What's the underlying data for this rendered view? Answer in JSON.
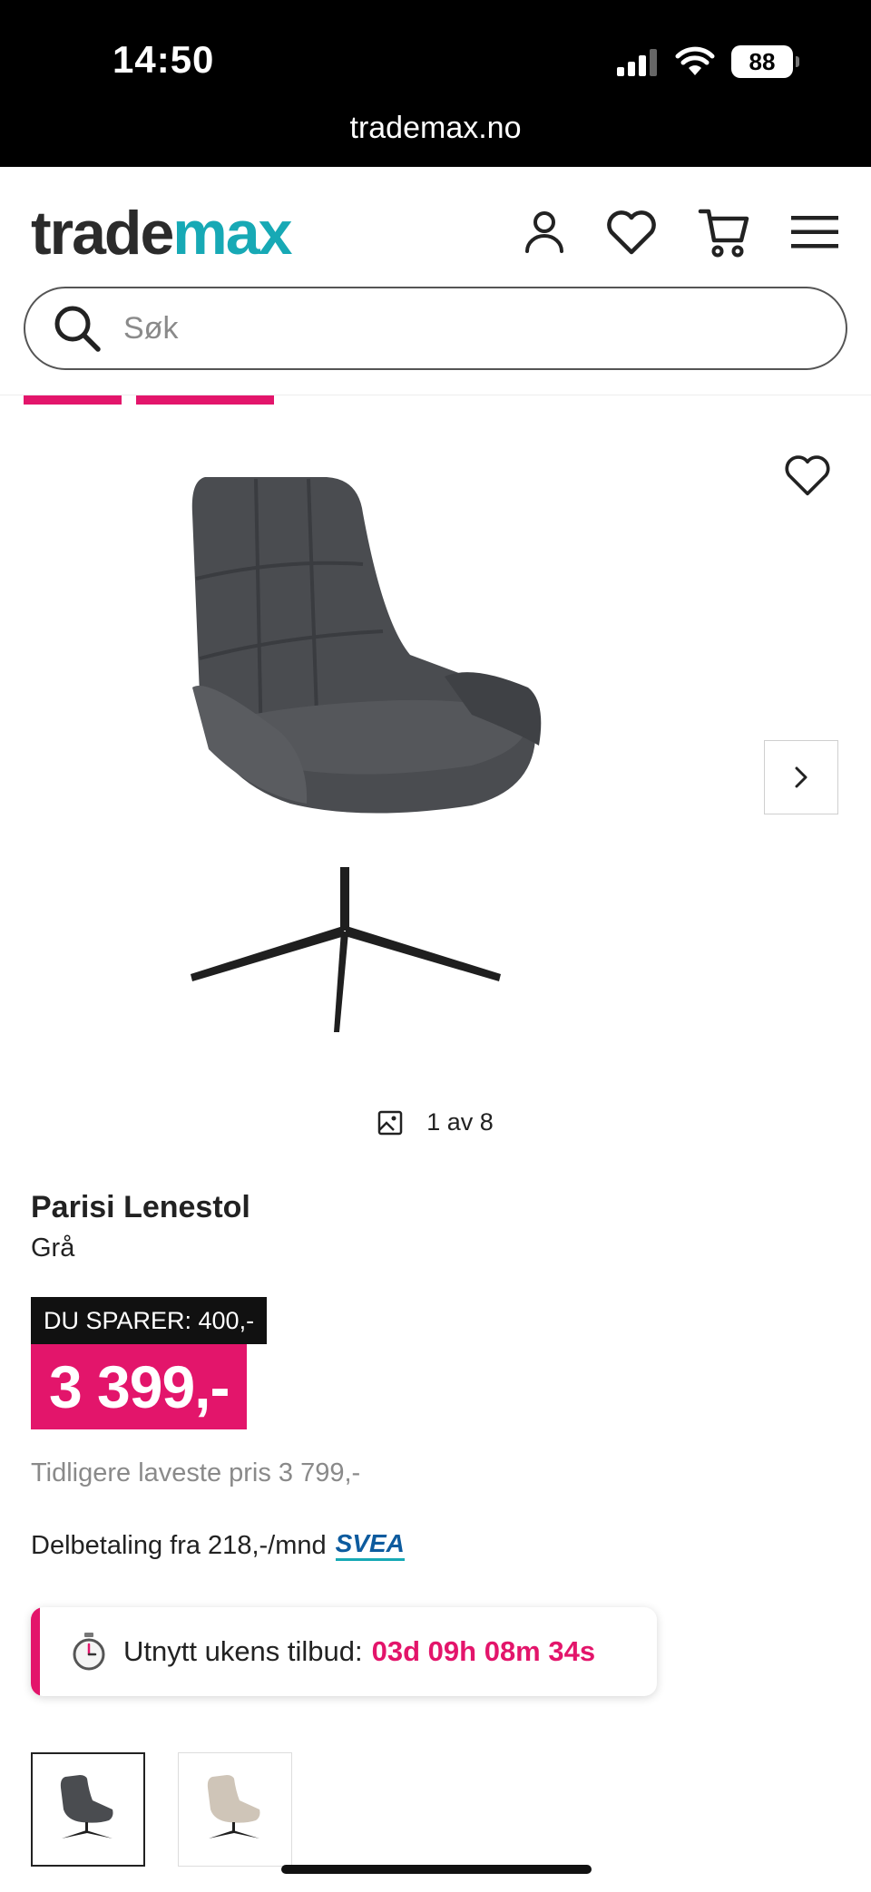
{
  "status_bar": {
    "time": "14:50",
    "battery": "88",
    "url": "trademax.no"
  },
  "header": {
    "logo_part1": "trade",
    "logo_part2": "max",
    "icons": [
      "user-icon",
      "heart-icon",
      "cart-icon",
      "menu-icon"
    ]
  },
  "search": {
    "placeholder": "Søk",
    "value": ""
  },
  "gallery": {
    "counter": "1 av 8",
    "total_images": 8,
    "current_image": 1
  },
  "product": {
    "title": "Parisi Lenestol",
    "variant": "Grå",
    "savings": "DU SPARER: 400,-",
    "price": "3 399,-",
    "previous_lowest_price": "Tidligere laveste pris 3 799,-",
    "installment": "Delbetaling fra 218,-/mnd",
    "installment_provider": "SVEA"
  },
  "offer": {
    "label": "Utnytt ukens tilbud:",
    "countdown": "03d 09h 08m 34s"
  },
  "colors": {
    "accent": "#e3156b",
    "brand_teal": "#17a9b5",
    "text": "#222222",
    "muted": "#8a8a8a"
  }
}
